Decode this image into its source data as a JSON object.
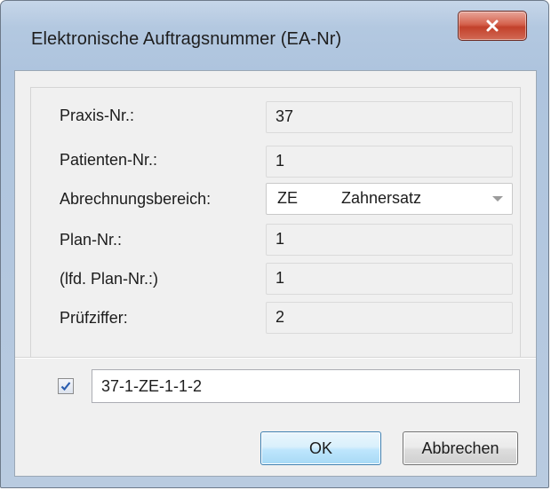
{
  "window": {
    "title": "Elektronische Auftragsnummer (EA-Nr)"
  },
  "fields": {
    "praxis_label": "Praxis-Nr.:",
    "praxis_value": "37",
    "patient_label": "Patienten-Nr.:",
    "patient_value": "1",
    "bereich_label": "Abrechnungsbereich:",
    "bereich_code": "ZE",
    "bereich_name": "Zahnersatz",
    "plan_label": "Plan-Nr.:",
    "plan_value": "1",
    "lfd_label": "(lfd. Plan-Nr.:)",
    "lfd_value": "1",
    "pruef_label": "Prüfziffer:",
    "pruef_value": "2"
  },
  "result": {
    "checked": true,
    "value": "37-1-ZE-1-1-2"
  },
  "buttons": {
    "ok": "OK",
    "cancel": "Abbrechen"
  },
  "colors": {
    "close_button": "#c8432c",
    "ok_border": "#3c7fb1",
    "frame": "#b3c8e0"
  }
}
